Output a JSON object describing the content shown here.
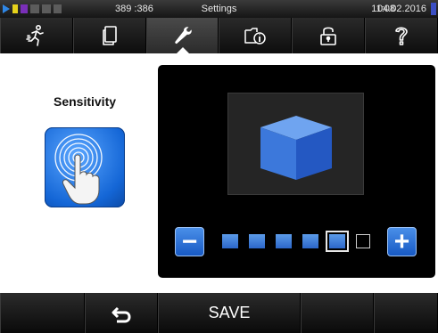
{
  "status_bar": {
    "coords": "389 :386",
    "title": "Settings",
    "time": "11:08",
    "date": "04.02.2016",
    "indicator_colors": [
      "#2f87e6",
      "#e6d21b",
      "#7a2fb8",
      "#6a6a6a",
      "#6a6a6a",
      "#6a6a6a"
    ]
  },
  "toolbar": {
    "tabs": [
      {
        "icon": "running-man-icon",
        "active": false
      },
      {
        "icon": "documents-icon",
        "active": false
      },
      {
        "icon": "wrench-icon",
        "active": true
      },
      {
        "icon": "info-folder-icon",
        "active": false
      },
      {
        "icon": "unlock-icon",
        "active": false
      },
      {
        "icon": "help-icon",
        "active": false
      }
    ]
  },
  "sensitivity": {
    "label": "Sensitivity",
    "level": 5,
    "max_level": 6,
    "decrease_label": "−",
    "increase_label": "+"
  },
  "bottom_bar": {
    "back_icon": "back-arrow-icon",
    "save_label": "SAVE"
  },
  "colors": {
    "accent": "#1f6fe0",
    "panel_bg": "#000000",
    "bar_bg": "#151515"
  }
}
